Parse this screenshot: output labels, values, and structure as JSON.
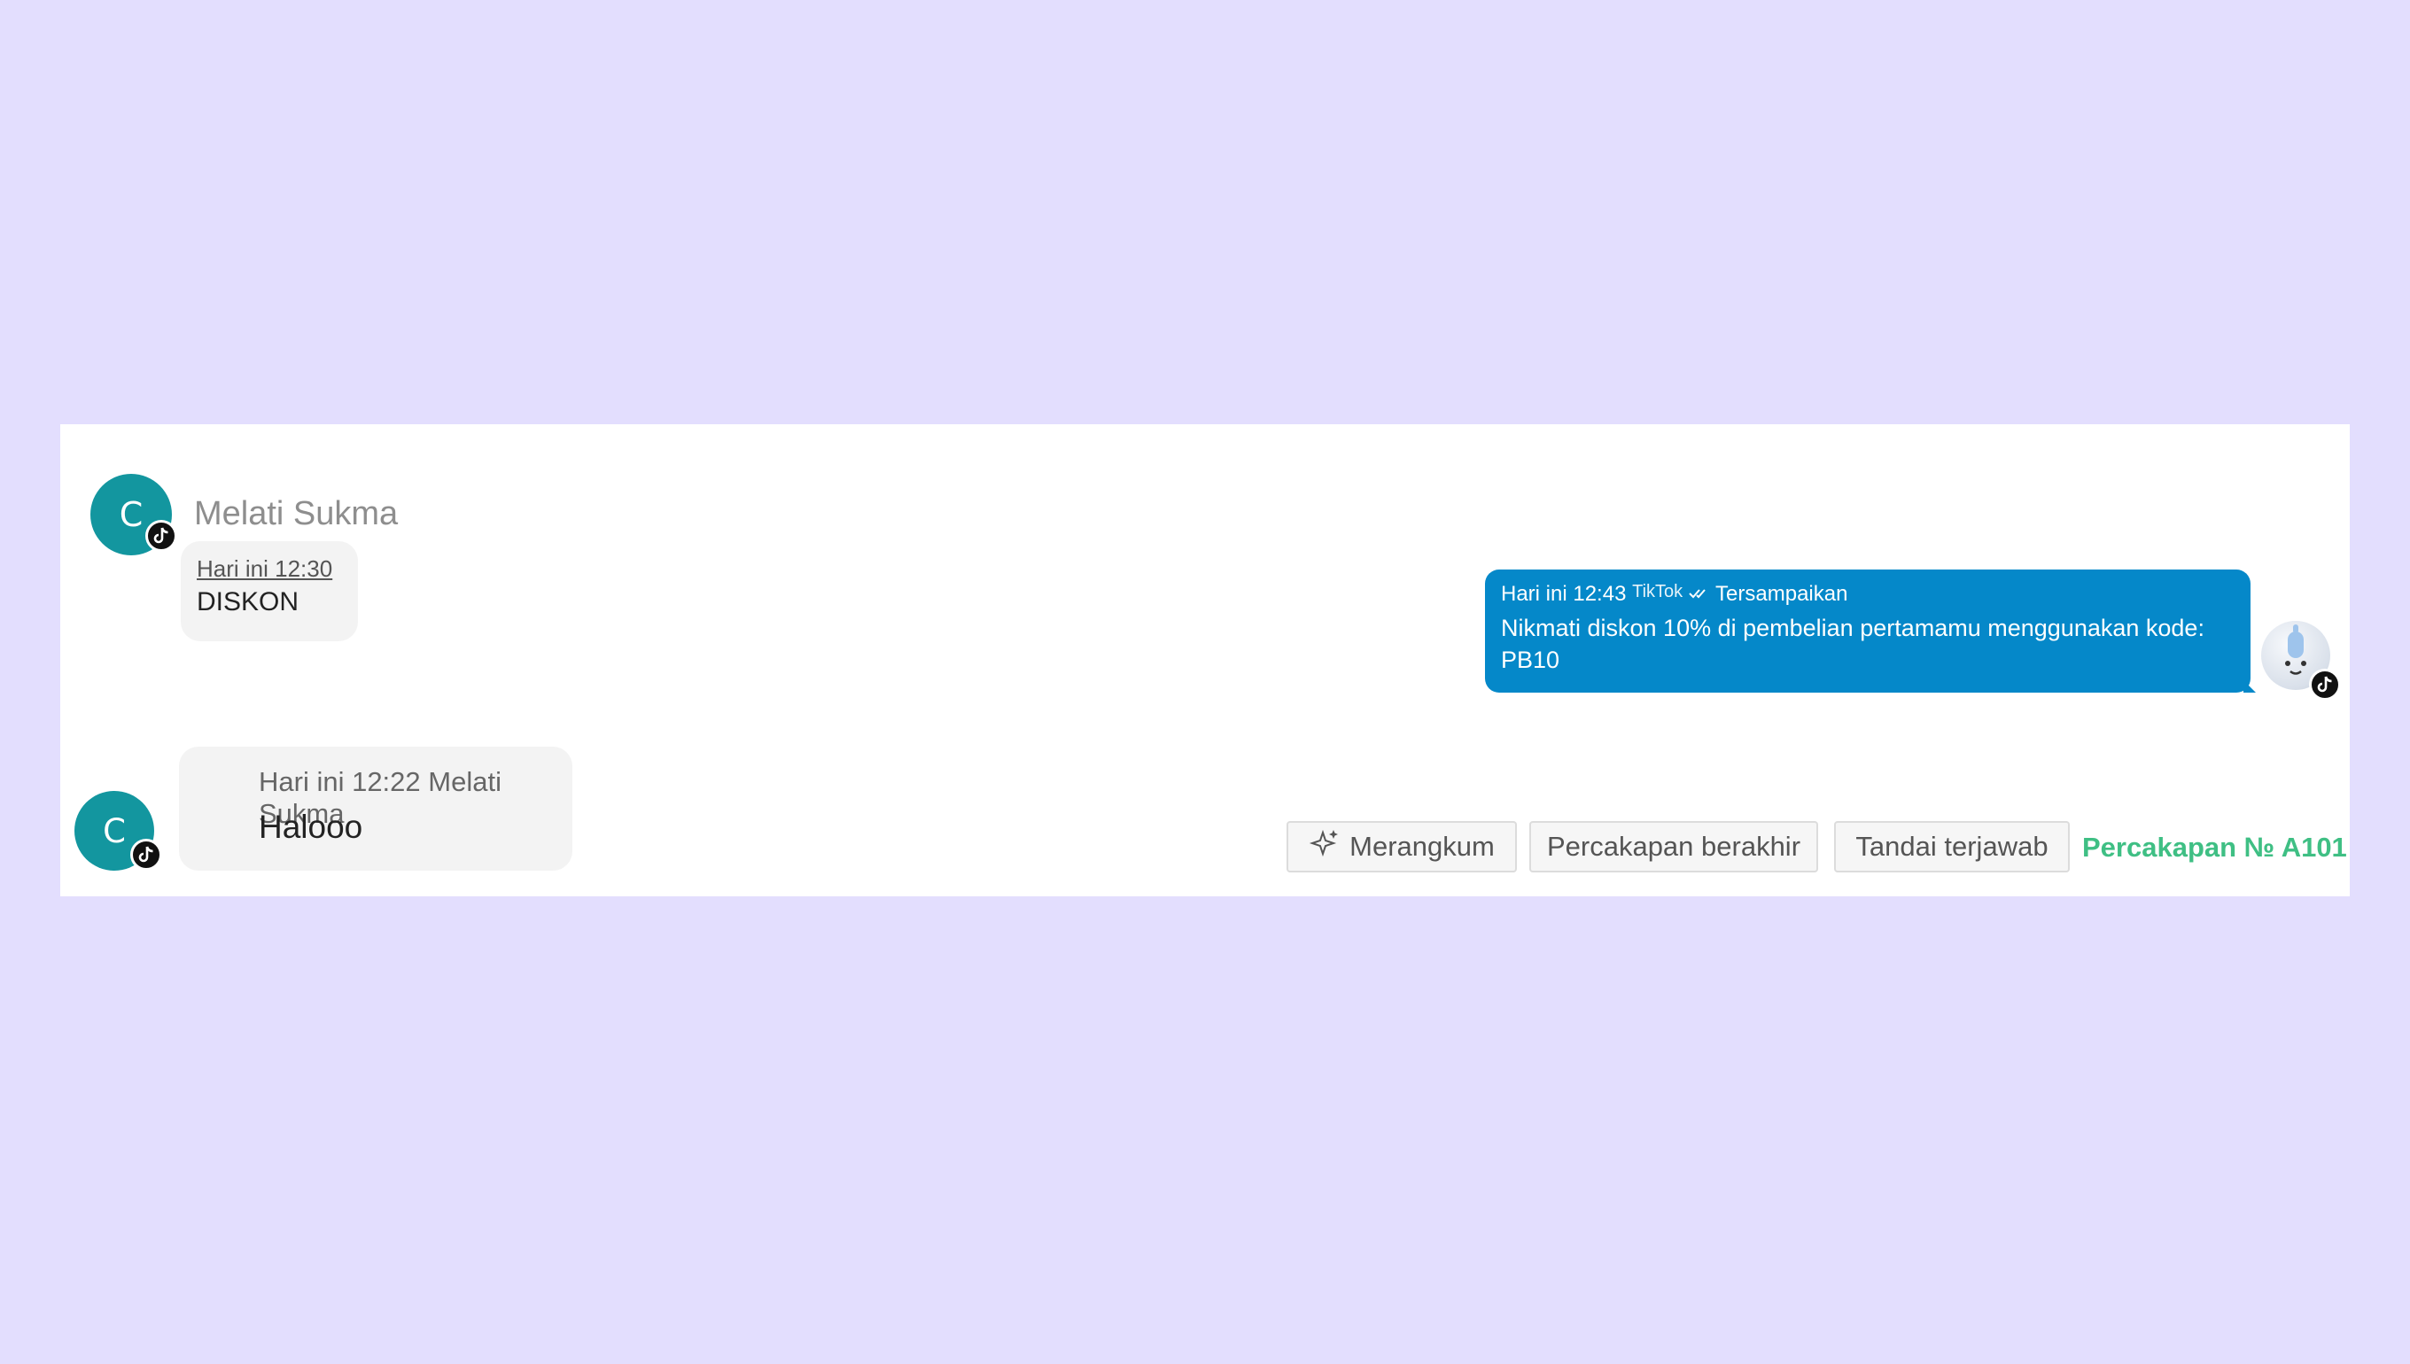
{
  "messages": {
    "first": {
      "avatar_letter": "C",
      "sender": "Melati Sukma",
      "time": "Hari ini 12:30",
      "text": "DISKON"
    },
    "outgoing": {
      "time": "Hari ini 12:43",
      "channel": "TikTok",
      "status_icon": "double-check-icon",
      "status": "Tersampaikan",
      "text": "Nikmati diskon 10% di pembelian pertamamu menggunakan kode: PB10"
    },
    "second": {
      "avatar_letter": "C",
      "meta": "Hari ini 12:22 Melati Sukma",
      "text": "Halooo"
    }
  },
  "actions": {
    "summarize_icon": "sparkle-icon",
    "summarize": "Merangkum",
    "end_conversation": "Percakapan berakhir",
    "mark_answered": "Tandai terjawab"
  },
  "conversation_id": "Percakapan № A101",
  "colors": {
    "background": "#e3defe",
    "avatar": "#13969f",
    "outgoing_bubble": "#0588c9",
    "conversation_id": "#3fbf84"
  }
}
